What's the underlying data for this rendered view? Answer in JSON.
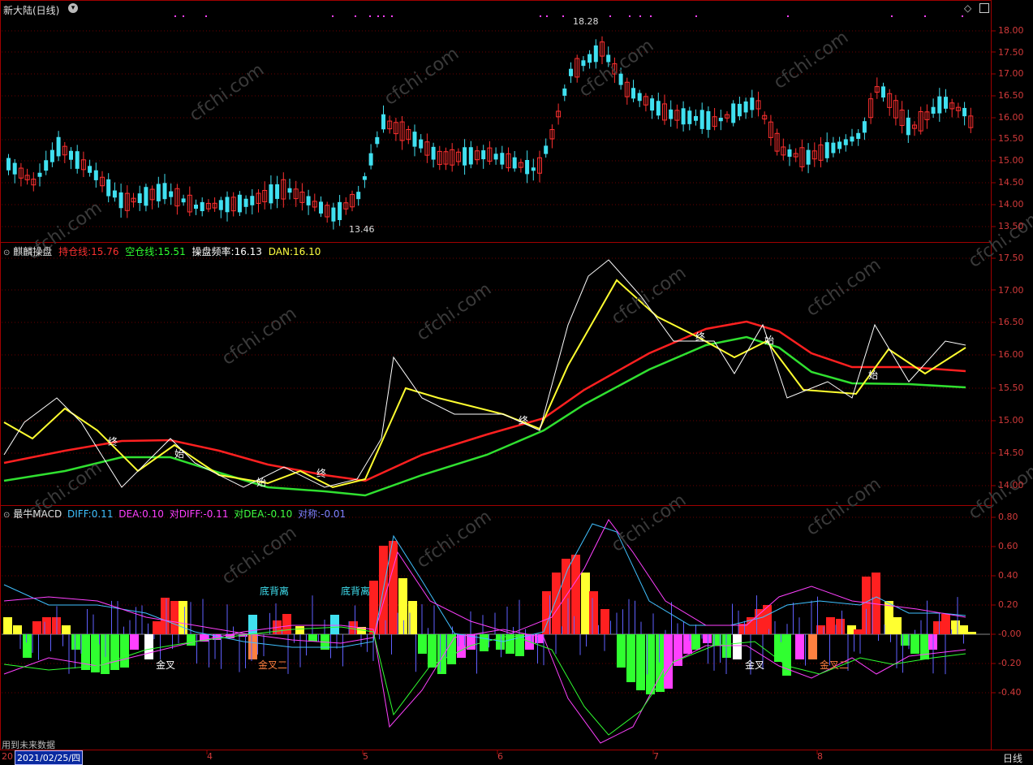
{
  "header": {
    "stock_name": "新大陆(日线)",
    "dropdown_icon": "chevron-down-icon",
    "diamond_icon": "diamond-icon",
    "minimize_icon": "minimize-icon"
  },
  "panel1": {
    "y_labels": [
      "18.00",
      "17.50",
      "17.00",
      "16.50",
      "16.00",
      "15.50",
      "15.00",
      "14.50",
      "14.00",
      "13.50"
    ],
    "high_label": "18.28",
    "low_label": "13.46"
  },
  "panel2": {
    "name": "麒麟操盘",
    "legend": [
      {
        "label": "持仓线:",
        "value": "15.76",
        "color": "#ff3030"
      },
      {
        "label": "空仓线:",
        "value": "15.51",
        "color": "#30ff30"
      },
      {
        "label": "操盘频率:",
        "value": "16.13",
        "color": "#ffffff"
      },
      {
        "label": "DAN:",
        "value": "16.10",
        "color": "#ffff40"
      }
    ],
    "y_labels": [
      "17.50",
      "17.00",
      "16.50",
      "16.00",
      "15.50",
      "15.00",
      "14.50",
      "14.00"
    ],
    "markers": [
      "终",
      "始",
      "始",
      "终",
      "终",
      "终",
      "始",
      "始"
    ]
  },
  "panel3": {
    "name": "最牛MACD",
    "legend": [
      {
        "label": "DIFF:",
        "value": "0.11",
        "color": "#40c0ff"
      },
      {
        "label": "DEA:",
        "value": "0.10",
        "color": "#ff40ff"
      },
      {
        "label": "对DIFF:",
        "value": "-0.11",
        "color": "#ff40ff"
      },
      {
        "label": "对DEA:",
        "value": "-0.10",
        "color": "#40ff40"
      },
      {
        "label": "对称:",
        "value": "-0.01",
        "color": "#8080ff"
      }
    ],
    "y_labels": [
      "0.80",
      "0.60",
      "0.40",
      "0.20",
      "-0.00",
      "-0.20",
      "-0.40"
    ],
    "annotations": [
      "底背离",
      "底背离",
      "金叉",
      "金叉二",
      "金叉",
      "金叉二"
    ]
  },
  "footer": {
    "future_data": "用到未来数据",
    "date_prefix": "20",
    "date_cursor": "2021/02/25/四",
    "months": [
      "4",
      "5",
      "6",
      "7",
      "8"
    ],
    "period": "日线"
  },
  "watermark": "cfchi.com",
  "colors": {
    "up": "#ff3030",
    "down": "#40e0f0",
    "border": "#a00000",
    "axis_text": "#d23a3a"
  }
}
